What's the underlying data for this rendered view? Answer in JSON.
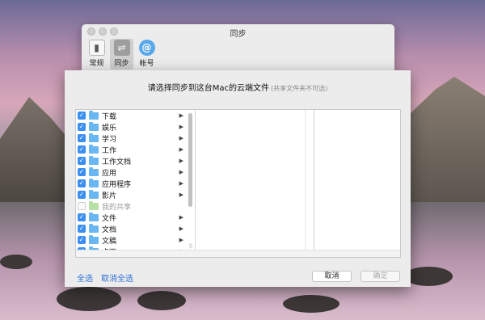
{
  "window": {
    "title": "同步"
  },
  "toolbar": {
    "items": [
      {
        "label": "常规",
        "icon": "general-icon"
      },
      {
        "label": "同步",
        "icon": "sync-icon"
      },
      {
        "label": "帐号",
        "icon": "account-icon"
      }
    ]
  },
  "sheet": {
    "title": "请选择同步到这台Mac的云端文件",
    "hint": "(共享文件夹不可选)"
  },
  "folders": [
    {
      "label": "下载",
      "checked": true
    },
    {
      "label": "娱乐",
      "checked": true
    },
    {
      "label": "学习",
      "checked": true
    },
    {
      "label": "工作",
      "checked": true
    },
    {
      "label": "工作文档",
      "checked": true
    },
    {
      "label": "应用",
      "checked": true
    },
    {
      "label": "应用程序",
      "checked": true
    },
    {
      "label": "影片",
      "checked": true
    },
    {
      "label": "我的共享",
      "checked": false,
      "disabled": true
    },
    {
      "label": "文件",
      "checked": true
    },
    {
      "label": "文档",
      "checked": true
    },
    {
      "label": "文稿",
      "checked": true
    },
    {
      "label": "桌面",
      "checked": true
    }
  ],
  "footer": {
    "select_all": "全选",
    "deselect_all": "取消全选",
    "cancel": "取消",
    "confirm": "确定"
  },
  "colors": {
    "accent": "#3b8ff0",
    "link": "#2b6fd6"
  }
}
